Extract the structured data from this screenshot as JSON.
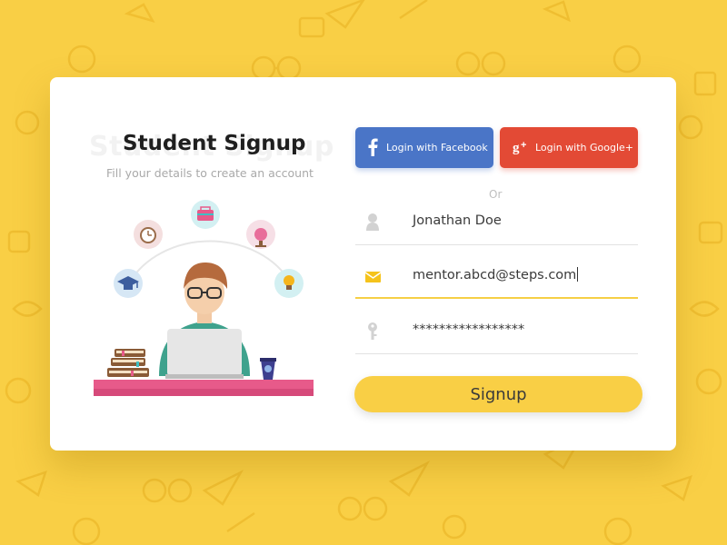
{
  "header": {
    "ghost_title": "Student Signup",
    "title": "Student Signup",
    "subtitle": "Fill your details to create an account"
  },
  "social": {
    "facebook_label": "Login with Facebook",
    "google_label": "Login with Google+"
  },
  "divider_text": "Or",
  "form": {
    "name_value": "Jonathan Doe",
    "email_value": "mentor.abcd@steps.com",
    "password_value": "*****************"
  },
  "submit_label": "Signup",
  "colors": {
    "background": "#f9cf45",
    "facebook": "#4a75c7",
    "google": "#e34a35",
    "accent": "#f9cf45"
  },
  "icons": {
    "name_field": "user-icon",
    "email_field": "envelope-icon",
    "password_field": "key-icon",
    "illustration": [
      "graduation-cap-icon",
      "alarm-clock-icon",
      "briefcase-icon",
      "globe-icon",
      "lightbulb-icon"
    ]
  }
}
